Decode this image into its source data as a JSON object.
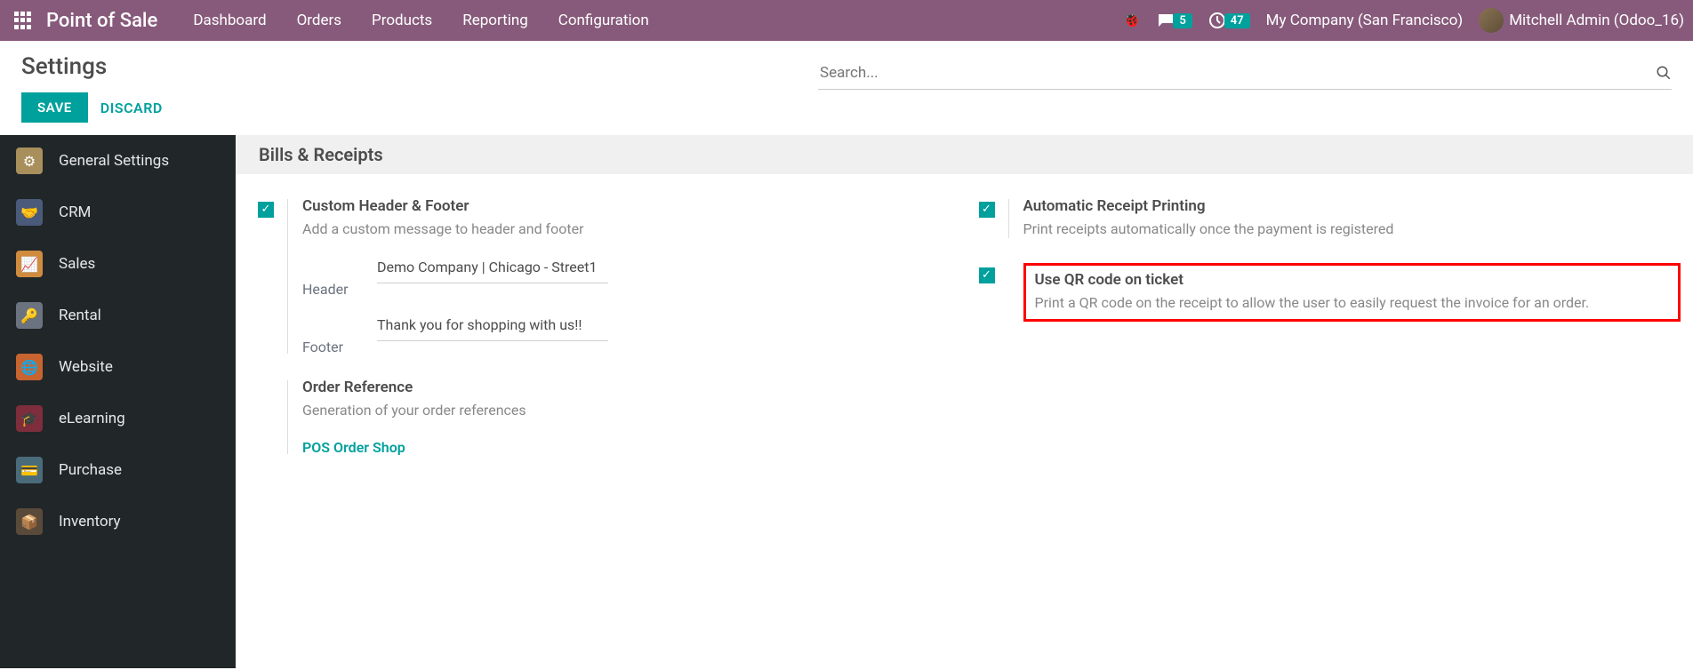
{
  "topnav": {
    "brand": "Point of Sale",
    "menu": [
      "Dashboard",
      "Orders",
      "Products",
      "Reporting",
      "Configuration"
    ],
    "msg_count": "5",
    "activity_count": "47",
    "company": "My Company (San Francisco)",
    "user": "Mitchell Admin (Odoo_16)"
  },
  "cp": {
    "title": "Settings",
    "save": "SAVE",
    "discard": "DISCARD",
    "search_placeholder": "Search..."
  },
  "sidebar": {
    "items": [
      {
        "label": "General Settings"
      },
      {
        "label": "CRM"
      },
      {
        "label": "Sales"
      },
      {
        "label": "Rental"
      },
      {
        "label": "Website"
      },
      {
        "label": "eLearning"
      },
      {
        "label": "Purchase"
      },
      {
        "label": "Inventory"
      }
    ]
  },
  "section": {
    "title": "Bills & Receipts",
    "custom_hf": {
      "title": "Custom Header & Footer",
      "desc": "Add a custom message to header and footer",
      "header_label": "Header",
      "header_val": "Demo Company | Chicago - Street1",
      "footer_label": "Footer",
      "footer_val": "Thank you for shopping with us!!"
    },
    "order_ref": {
      "title": "Order Reference",
      "desc": "Generation of your order references",
      "link": "POS Order Shop"
    },
    "auto_print": {
      "title": "Automatic Receipt Printing",
      "desc": "Print receipts automatically once the payment is registered"
    },
    "qr": {
      "title": "Use QR code on ticket",
      "desc": "Print a QR code on the receipt to allow the user to easily request the invoice for an order."
    }
  }
}
